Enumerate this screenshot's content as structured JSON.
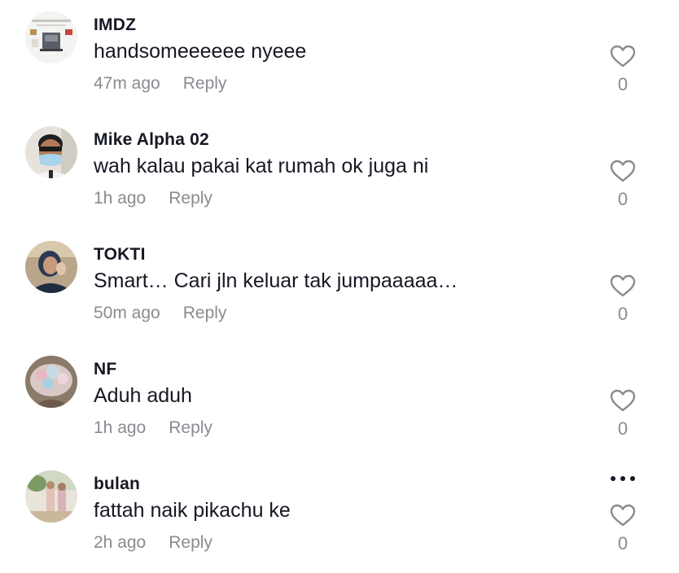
{
  "comments": [
    {
      "username": "IMDZ",
      "text": "handsomeeeeee nyeee",
      "time": "47m ago",
      "reply_label": "Reply",
      "likes": "0"
    },
    {
      "username": "Mike Alpha 02",
      "text": "wah kalau pakai kat rumah ok juga ni",
      "time": "1h ago",
      "reply_label": "Reply",
      "likes": "0"
    },
    {
      "username": "TOKTI",
      "text": "Smart… Cari jln keluar tak jumpaaaaa…",
      "time": "50m ago",
      "reply_label": "Reply",
      "likes": "0"
    },
    {
      "username": "NF",
      "text": "Aduh aduh",
      "time": "1h ago",
      "reply_label": "Reply",
      "likes": "0"
    },
    {
      "username": "bulan",
      "text": "fattah naik pikachu ke",
      "time": "2h ago",
      "reply_label": "Reply",
      "likes": "0"
    }
  ],
  "icons": {
    "like": "heart-outline-icon",
    "more": "more-horizontal-icon"
  },
  "colors": {
    "text": "#161823",
    "muted": "#8a8b91"
  }
}
